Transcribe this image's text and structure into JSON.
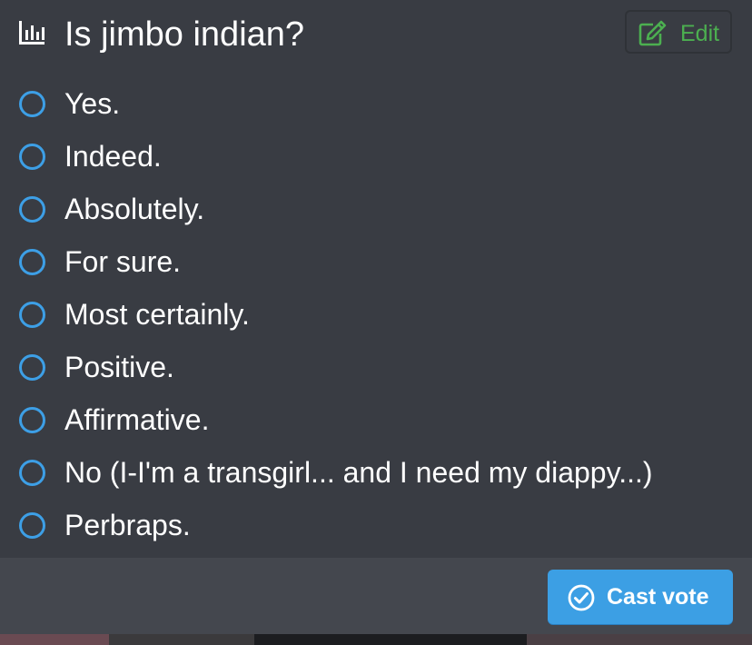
{
  "poll": {
    "icon": "bar-chart-icon",
    "title": "Is jimbo indian?",
    "edit_button": {
      "icon": "edit-icon",
      "label": "Edit",
      "color": "#4caf50"
    },
    "options": [
      {
        "label": "Yes."
      },
      {
        "label": "Indeed."
      },
      {
        "label": "Absolutely."
      },
      {
        "label": "For sure."
      },
      {
        "label": "Most certainly."
      },
      {
        "label": "Positive."
      },
      {
        "label": "Affirmative."
      },
      {
        "label": "No (I-I'm a transgirl... and I need my diappy...)"
      },
      {
        "label": "Perbraps."
      }
    ],
    "cast_vote_button": {
      "icon": "check-circle-icon",
      "label": "Cast vote",
      "color": "#3c9fe4"
    }
  },
  "colors": {
    "background": "#393c43",
    "footer": "#44474e",
    "radio": "#3d9fe6",
    "text": "#ffffff"
  }
}
